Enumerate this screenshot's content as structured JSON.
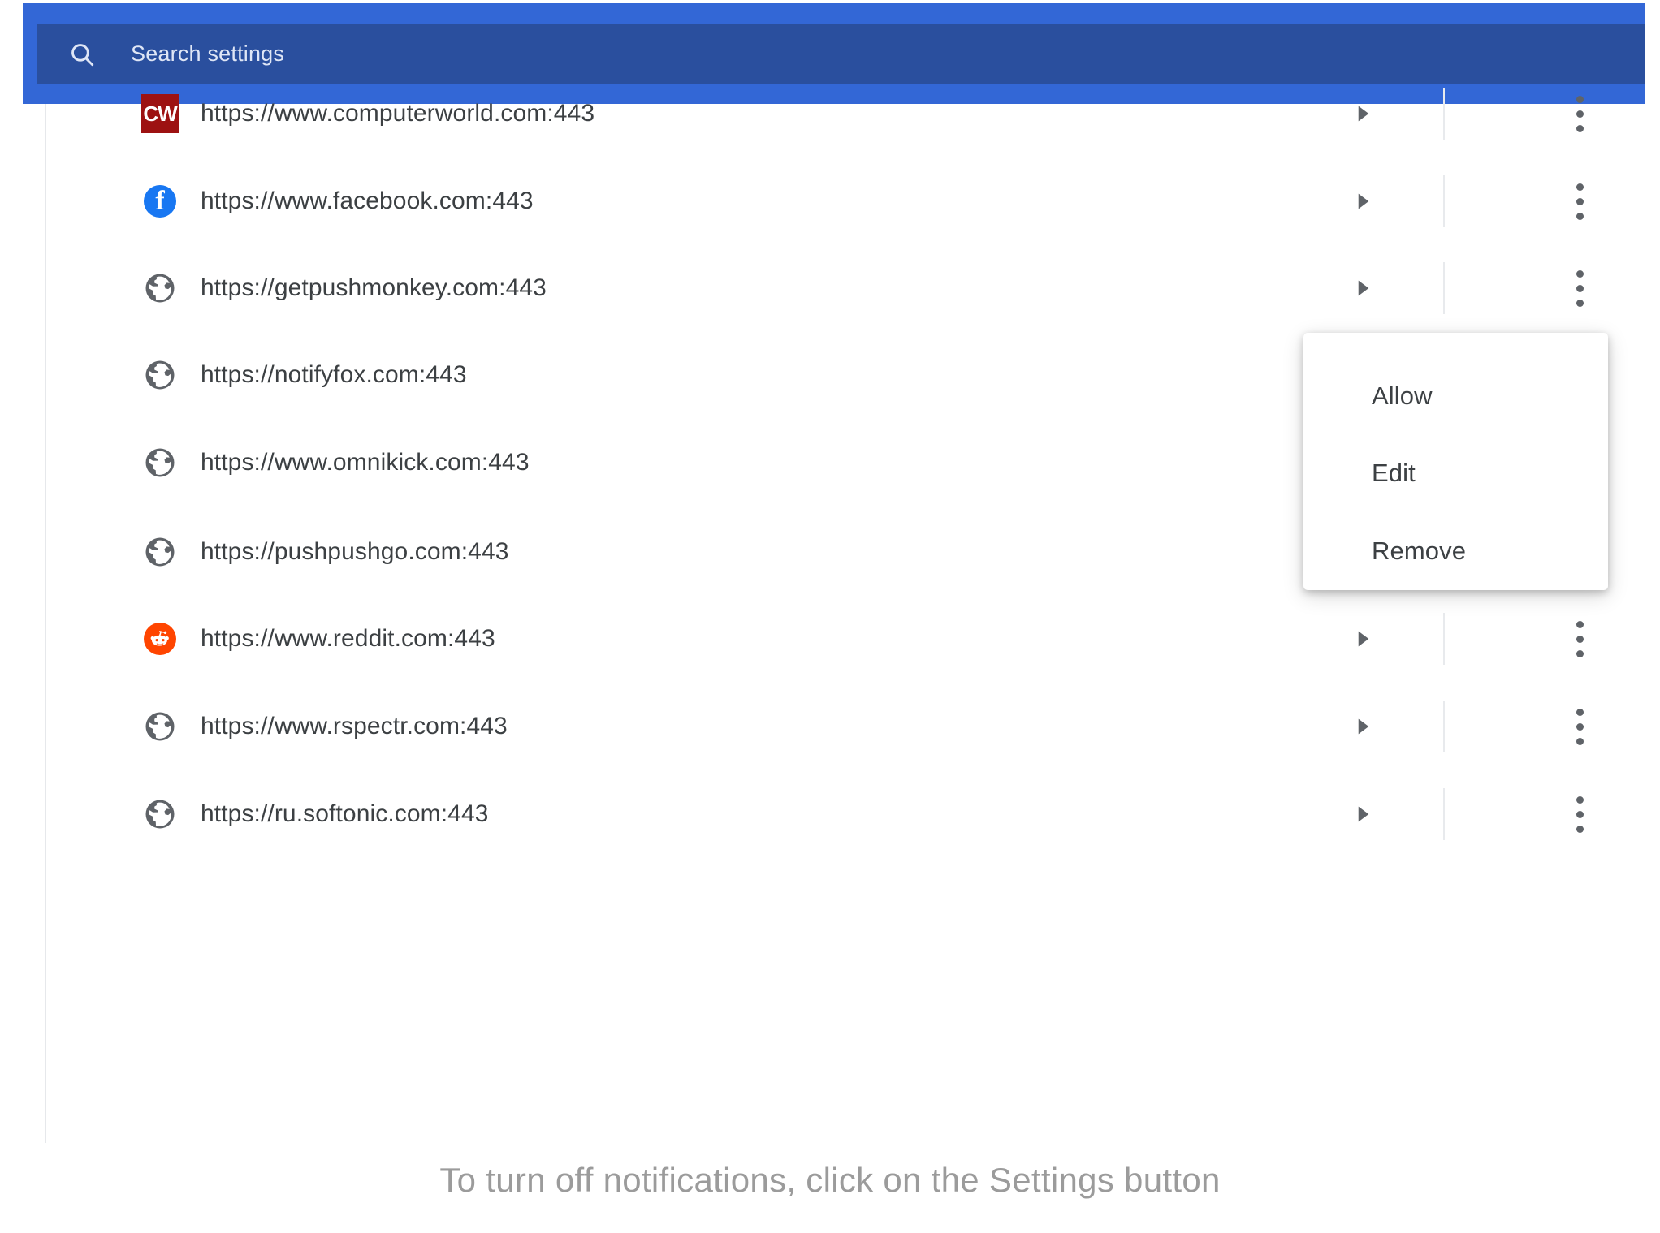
{
  "search": {
    "placeholder": "Search settings",
    "icon": "search-icon"
  },
  "colors": {
    "bar_outer": "#3367d6",
    "bar_inner": "#2a4f9e",
    "facebook": "#1877f2",
    "reddit": "#ff4500",
    "computerworld": "#9d1212",
    "text": "#3c4043",
    "caption": "#9b9b9b"
  },
  "site_list": {
    "rows": [
      {
        "url": "https://www.computerworld.com:443",
        "icon": "computerworld-icon",
        "icon_label": "CW",
        "arrow": "▸",
        "menu": "overflow-menu-icon"
      },
      {
        "url": "https://www.facebook.com:443",
        "icon": "facebook-icon",
        "icon_label": "f",
        "arrow": "▸",
        "menu": "overflow-menu-icon"
      },
      {
        "url": "https://getpushmonkey.com:443",
        "icon": "globe-icon",
        "icon_label": "",
        "arrow": "▸",
        "menu": "overflow-menu-icon"
      },
      {
        "url": "https://notifyfox.com:443",
        "icon": "globe-icon",
        "icon_label": "",
        "arrow": "▸",
        "menu": "overflow-menu-icon"
      },
      {
        "url": "https://www.omnikick.com:443",
        "icon": "globe-icon",
        "icon_label": "",
        "arrow": "▸",
        "menu": "overflow-menu-icon"
      },
      {
        "url": "https://pushpushgo.com:443",
        "icon": "globe-icon",
        "icon_label": "",
        "arrow": "▸",
        "menu": "overflow-menu-icon"
      },
      {
        "url": "https://www.reddit.com:443",
        "icon": "reddit-icon",
        "icon_label": "",
        "arrow": "▸",
        "menu": "overflow-menu-icon"
      },
      {
        "url": "https://www.rspectr.com:443",
        "icon": "globe-icon",
        "icon_label": "",
        "arrow": "▸",
        "menu": "overflow-menu-icon"
      },
      {
        "url": "https://ru.softonic.com:443",
        "icon": "globe-icon",
        "icon_label": "",
        "arrow": "▸",
        "menu": "overflow-menu-icon"
      }
    ]
  },
  "context_menu": {
    "items": [
      {
        "label": "Allow"
      },
      {
        "label": "Edit"
      },
      {
        "label": "Remove"
      }
    ]
  },
  "caption": {
    "text": "To turn off notifications, click on the Settings button"
  }
}
